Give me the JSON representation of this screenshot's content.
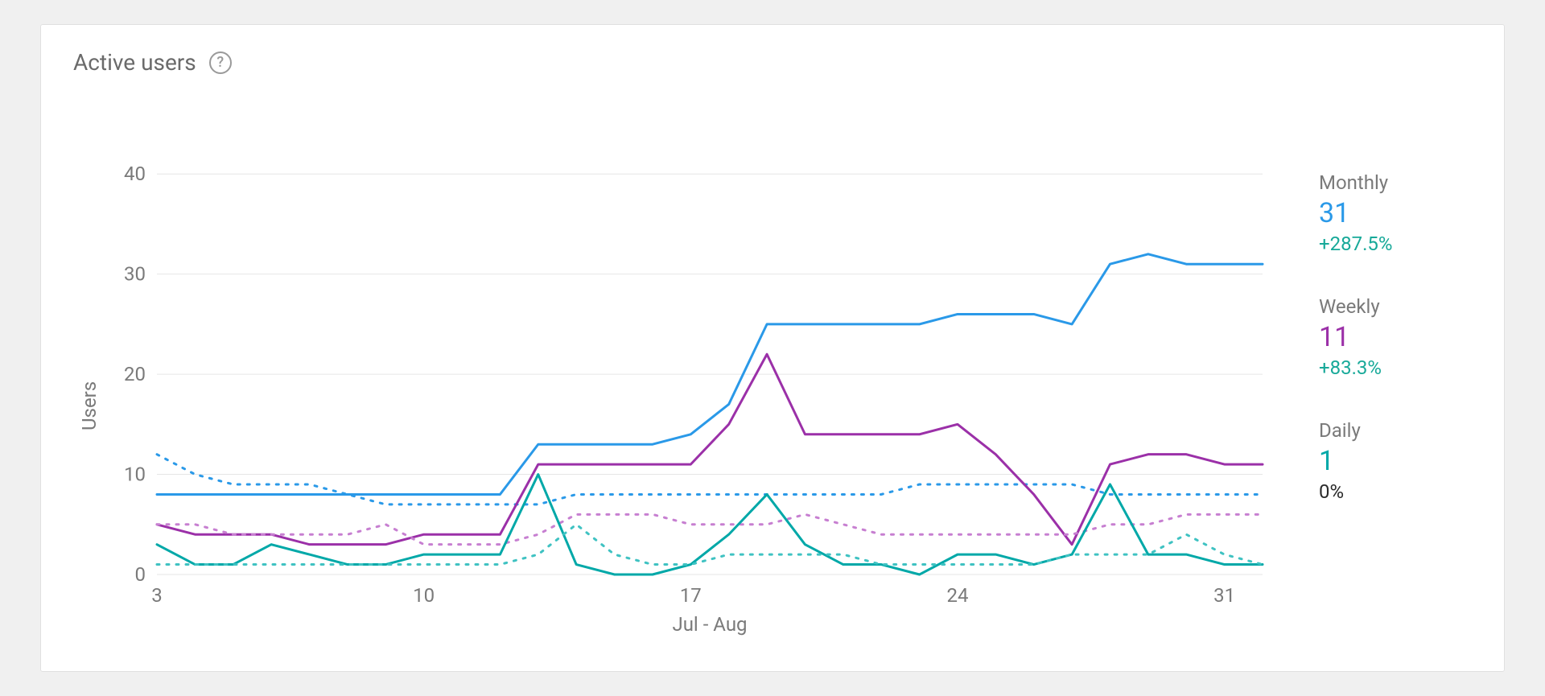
{
  "title": "Active users",
  "help_tooltip": "?",
  "legend": {
    "monthly": {
      "label": "Monthly",
      "value": "31",
      "delta": "+287.5%",
      "color": "#2a99e8",
      "delta_color": "#18a999"
    },
    "weekly": {
      "label": "Weekly",
      "value": "11",
      "delta": "+83.3%",
      "color": "#9b30a8",
      "delta_color": "#18a999"
    },
    "daily": {
      "label": "Daily",
      "value": "1",
      "delta": "0%",
      "color": "#00a8a8",
      "delta_color": "#2b2b2b"
    }
  },
  "chart_data": {
    "type": "line",
    "title": "Active users",
    "xlabel": "Jul - Aug",
    "ylabel": "Users",
    "x_ticks": [
      "3",
      "10",
      "17",
      "24",
      "31"
    ],
    "y_ticks": [
      0,
      10,
      20,
      30,
      40
    ],
    "ylim": [
      0,
      45
    ],
    "x": [
      3,
      4,
      5,
      6,
      7,
      8,
      9,
      10,
      11,
      12,
      13,
      14,
      15,
      16,
      17,
      18,
      19,
      20,
      21,
      22,
      23,
      24,
      25,
      26,
      27,
      28,
      29,
      30,
      31,
      32
    ],
    "series": [
      {
        "name": "Monthly",
        "color": "#2a99e8",
        "style": "solid",
        "values": [
          8,
          8,
          8,
          8,
          8,
          8,
          8,
          8,
          8,
          8,
          13,
          13,
          13,
          13,
          14,
          17,
          25,
          25,
          25,
          25,
          25,
          26,
          26,
          26,
          25,
          31,
          32,
          31,
          31,
          31
        ]
      },
      {
        "name": "Monthly (previous period)",
        "color": "#2a99e8",
        "style": "dashed",
        "values": [
          12,
          10,
          9,
          9,
          9,
          8,
          7,
          7,
          7,
          7,
          7,
          8,
          8,
          8,
          8,
          8,
          8,
          8,
          8,
          8,
          9,
          9,
          9,
          9,
          9,
          8,
          8,
          8,
          8,
          8
        ]
      },
      {
        "name": "Weekly",
        "color": "#9b30a8",
        "style": "solid",
        "values": [
          5,
          4,
          4,
          4,
          3,
          3,
          3,
          4,
          4,
          4,
          11,
          11,
          11,
          11,
          11,
          15,
          22,
          14,
          14,
          14,
          14,
          15,
          12,
          8,
          3,
          11,
          12,
          12,
          11,
          11
        ]
      },
      {
        "name": "Weekly (previous period)",
        "color": "#c77fd1",
        "style": "dashed",
        "values": [
          5,
          5,
          4,
          4,
          4,
          4,
          5,
          3,
          3,
          3,
          4,
          6,
          6,
          6,
          5,
          5,
          5,
          6,
          5,
          4,
          4,
          4,
          4,
          4,
          4,
          5,
          5,
          6,
          6,
          6
        ]
      },
      {
        "name": "Daily",
        "color": "#00a8a8",
        "style": "solid",
        "values": [
          3,
          1,
          1,
          3,
          2,
          1,
          1,
          2,
          2,
          2,
          10,
          1,
          0,
          0,
          1,
          4,
          8,
          3,
          1,
          1,
          0,
          2,
          2,
          1,
          2,
          9,
          2,
          2,
          1,
          1
        ]
      },
      {
        "name": "Daily (previous period)",
        "color": "#3fc2c2",
        "style": "dashed",
        "values": [
          1,
          1,
          1,
          1,
          1,
          1,
          1,
          1,
          1,
          1,
          2,
          5,
          2,
          1,
          1,
          2,
          2,
          2,
          2,
          1,
          1,
          1,
          1,
          1,
          2,
          2,
          2,
          4,
          2,
          1
        ]
      }
    ]
  }
}
